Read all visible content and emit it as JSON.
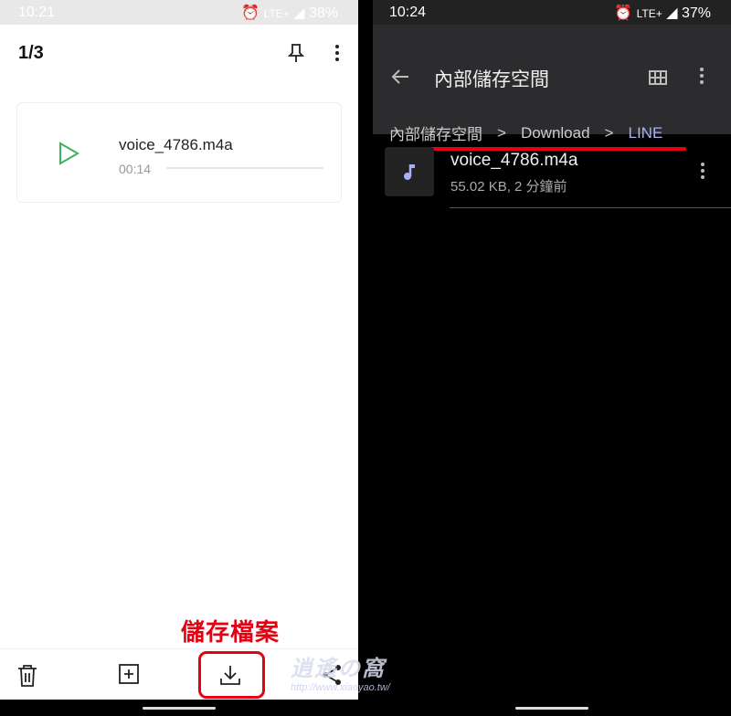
{
  "left": {
    "status": {
      "time": "10:21",
      "network": "LTE+",
      "battery": "38%"
    },
    "header": {
      "title": "1/3",
      "icons": [
        "pin-icon",
        "more-vert-icon"
      ]
    },
    "file": {
      "name": "voice_4786.m4a",
      "duration": "00:14",
      "progress": 0
    },
    "annotation": "儲存檔案",
    "toolbar": {
      "icons": [
        "trash-icon",
        "add-box-icon",
        "download-icon",
        "share-icon"
      ]
    },
    "accent": "#3cb55a"
  },
  "right": {
    "status": {
      "time": "10:24",
      "network": "LTE+",
      "battery": "37%"
    },
    "appbar": {
      "title": "內部儲存空間"
    },
    "breadcrumb": [
      "內部儲存空間",
      "Download",
      "LINE"
    ],
    "file": {
      "name": "voice_4786.m4a",
      "meta": "55.02 KB, 2 分鐘前"
    },
    "accent": "#a8b0f8"
  },
  "watermark": {
    "logo": "逍遙の窩",
    "url": "http://www.xiaoyao.tw/"
  },
  "highlight_color": "#e50012"
}
